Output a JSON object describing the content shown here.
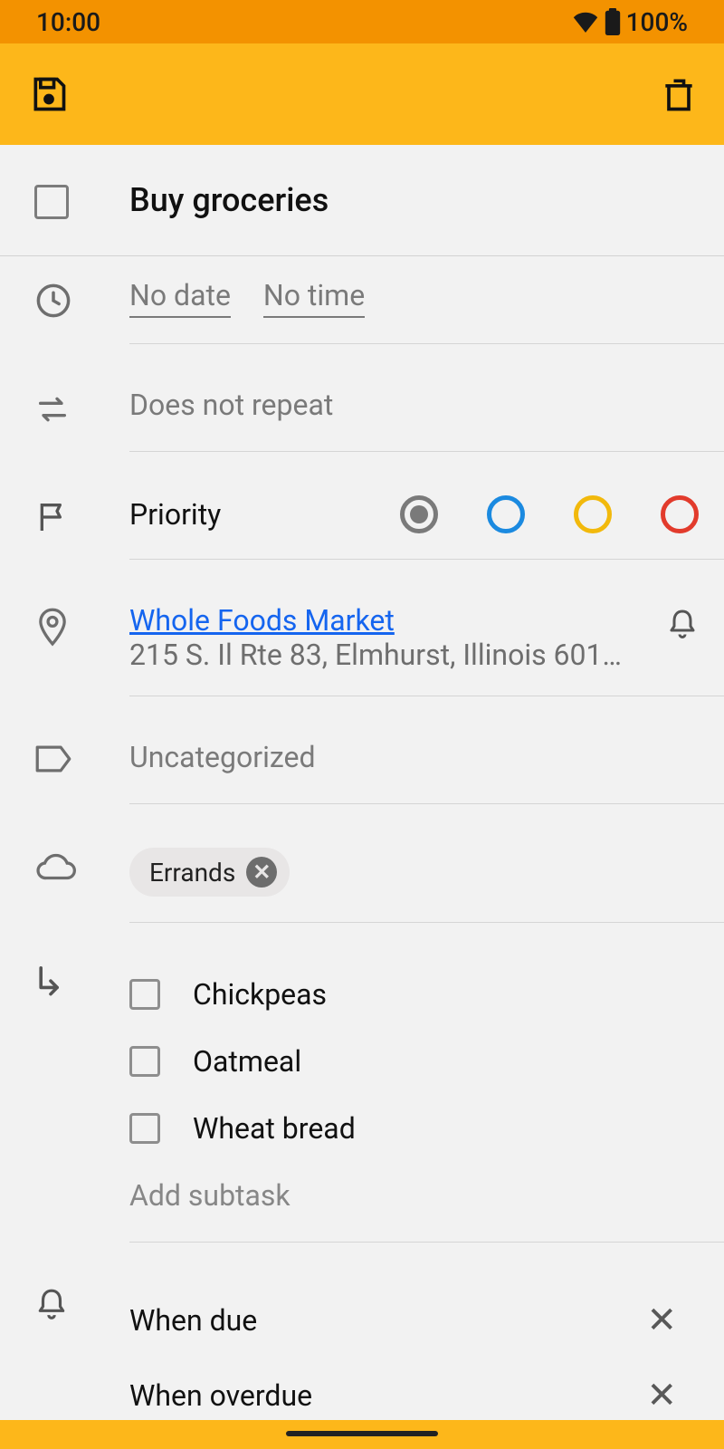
{
  "status": {
    "time": "10:00",
    "battery": "100%"
  },
  "task": {
    "title": "Buy groceries",
    "date": "No date",
    "time": "No time",
    "repeat": "Does not repeat",
    "priority_label": "Priority",
    "priority_colors": [
      "#7a7a7a",
      "#1b8ae0",
      "#f2b90c",
      "#e23b2c"
    ],
    "location": {
      "name": "Whole Foods Market",
      "address": "215 S. Il Rte 83, Elmhurst, Illinois 601…"
    },
    "category": "Uncategorized",
    "list_chip": "Errands",
    "subtasks": [
      "Chickpeas",
      "Oatmeal",
      "Wheat bread"
    ],
    "add_subtask": "Add subtask",
    "reminders": [
      "When due",
      "When overdue"
    ]
  }
}
